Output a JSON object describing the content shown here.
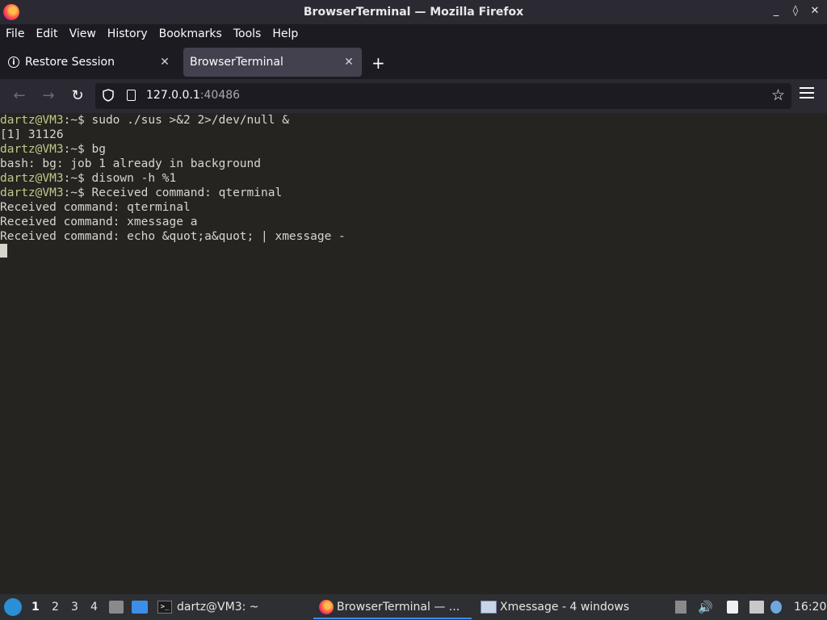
{
  "window": {
    "title": "BrowserTerminal — Mozilla Firefox",
    "controls": [
      "_",
      "◊",
      "✕"
    ]
  },
  "menu": {
    "items": [
      "File",
      "Edit",
      "View",
      "History",
      "Bookmarks",
      "Tools",
      "Help"
    ]
  },
  "tabs": [
    {
      "label": "Restore Session",
      "active": false
    },
    {
      "label": "BrowserTerminal",
      "active": true
    }
  ],
  "url": {
    "host": "127.0.0.1",
    "port": ":40486"
  },
  "terminal": {
    "lines": [
      {
        "user": "dartz@VM3",
        "rest": ":~$ sudo ./sus >&2 2>/dev/null &"
      },
      {
        "user": "",
        "rest": "[1] 31126"
      },
      {
        "user": "dartz@VM3",
        "rest": ":~$ bg"
      },
      {
        "user": "",
        "rest": "bash: bg: job 1 already in background"
      },
      {
        "user": "dartz@VM3",
        "rest": ":~$ disown -h %1"
      },
      {
        "user": "dartz@VM3",
        "rest": ":~$ Received command: qterminal"
      },
      {
        "user": "",
        "rest": "Received command: qterminal"
      },
      {
        "user": "",
        "rest": "Received command: xmessage a"
      },
      {
        "user": "",
        "rest": "Received command: echo &quot;a&quot; | xmessage -"
      }
    ]
  },
  "taskbar": {
    "desktops": [
      "1",
      "2",
      "3",
      "4"
    ],
    "active_desktop": "1",
    "tasks": {
      "terminal": "dartz@VM3: ~",
      "firefox": "BrowserTerminal — ...",
      "xmessage": "Xmessage - 4 windows"
    },
    "clock": "16:20"
  },
  "colors": {
    "accent": "#3d8ee8",
    "prompt": "#c2c78a",
    "terminal_bg": "#252420"
  },
  "icons": [
    "firefox-icon",
    "info-icon",
    "back-arrow-icon",
    "forward-arrow-icon",
    "reload-icon",
    "shield-icon",
    "page-icon",
    "star-icon",
    "hamburger-menu-icon",
    "start-menu-icon",
    "files-icon",
    "desktop-icon",
    "terminal-icon",
    "xmessage-icon",
    "volume-icon",
    "clipboard-icon",
    "network-icon",
    "update-icon"
  ]
}
